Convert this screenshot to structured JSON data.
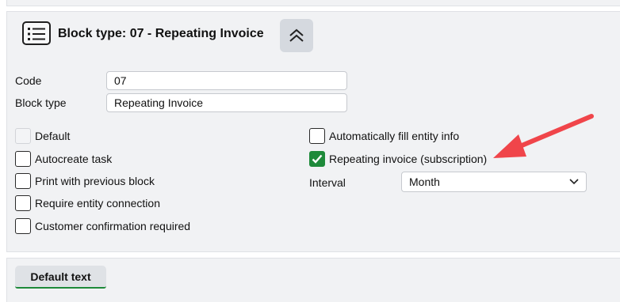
{
  "header": {
    "icon": "list-icon",
    "title": "Block type: 07 - Repeating Invoice",
    "collapse_icon": "double-chevron-up-icon"
  },
  "fields": {
    "code": {
      "label": "Code",
      "value": "07"
    },
    "block_type": {
      "label": "Block type",
      "value": "Repeating Invoice"
    }
  },
  "checkboxes_left": [
    {
      "label": "Default",
      "checked": false,
      "disabled": true
    },
    {
      "label": "Autocreate task",
      "checked": false,
      "disabled": false
    },
    {
      "label": "Print with previous block",
      "checked": false,
      "disabled": false
    },
    {
      "label": "Require entity connection",
      "checked": false,
      "disabled": false
    },
    {
      "label": "Customer confirmation required",
      "checked": false,
      "disabled": false
    }
  ],
  "checkboxes_right": [
    {
      "label": "Automatically fill entity info",
      "checked": false,
      "disabled": false
    },
    {
      "label": "Repeating invoice (subscription)",
      "checked": true,
      "disabled": false
    }
  ],
  "interval": {
    "label": "Interval",
    "value": "Month"
  },
  "footer": {
    "tab_label": "Default text"
  },
  "colors": {
    "accent_green": "#1e8a3a",
    "annotation_arrow": "#f0454a",
    "panel_bg": "#f1f2f4"
  }
}
